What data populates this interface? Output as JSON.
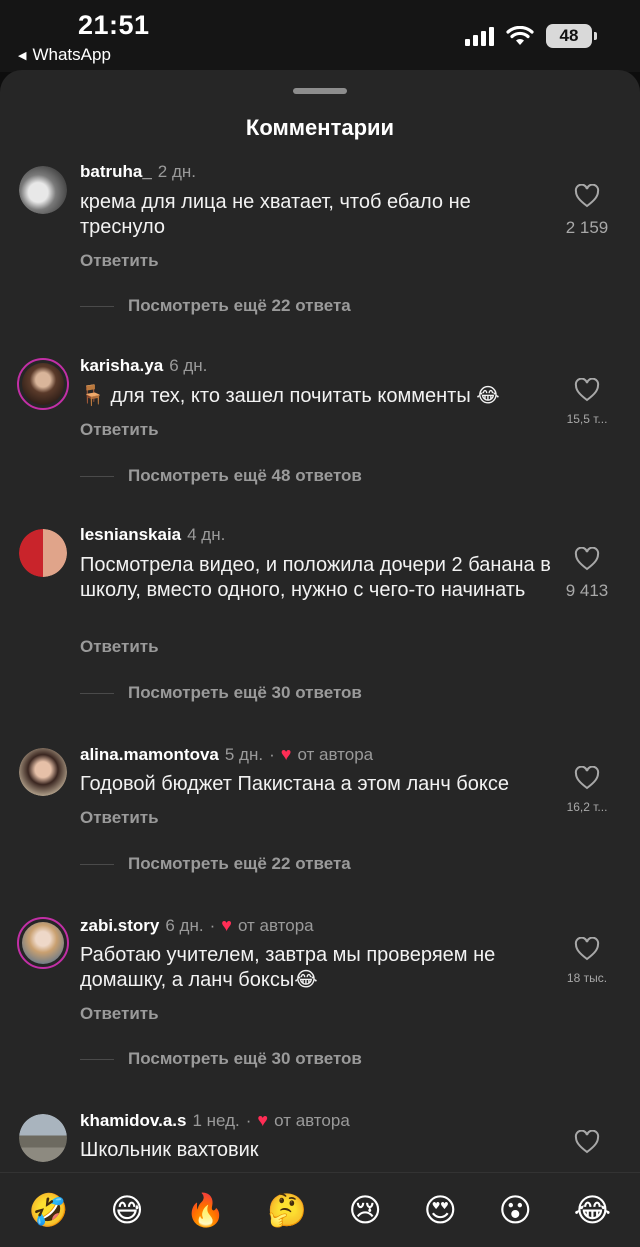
{
  "status_bar": {
    "time": "21:51",
    "back_app": "WhatsApp",
    "battery": "48"
  },
  "sheet": {
    "title": "Комментарии"
  },
  "comments": [
    {
      "user": "batruha_",
      "date": "2 дн.",
      "text": "крема для лица не хватает, чтоб ебало не треснуло",
      "likes": "2 159",
      "reply": "Ответить",
      "more": "Посмотреть ещё 22 ответа",
      "author_like": false
    },
    {
      "user": "karisha.ya",
      "date": "6 дн.",
      "text": "🪑 для тех, кто зашел почитать комменты 😂",
      "likes": "15,5 т...",
      "reply": "Ответить",
      "more": "Посмотреть ещё 48 ответов",
      "author_like": false
    },
    {
      "user": "lesnianskaia",
      "date": "4 дн.",
      "text": "Посмотрела видео, и положила дочери 2 банана в школу, вместо одного, нужно с чего-то начинать",
      "likes": "9 413",
      "reply": "Ответить",
      "more": "Посмотреть ещё 30 ответов",
      "author_like": false
    },
    {
      "user": "alina.mamontova",
      "date": "5 дн.",
      "author_label": "от автора",
      "text": "Годовой бюджет Пакистана а этом ланч боксе",
      "likes": "16,2 т...",
      "reply": "Ответить",
      "more": "Посмотреть ещё 22 ответа",
      "author_like": true
    },
    {
      "user": "zabi.story",
      "date": "6 дн.",
      "author_label": "от автора",
      "text": "Работаю учителем, завтра мы проверяем не домашку, а ланч боксы😂",
      "likes": "18 тыс.",
      "reply": "Ответить",
      "more": "Посмотреть ещё 30 ответов",
      "author_like": true
    },
    {
      "user": "khamidov.a.s",
      "date": "1 нед.",
      "author_label": "от автора",
      "text": "Школьник вахтовик",
      "likes": "",
      "author_like": true
    }
  ],
  "separator": "·",
  "emoji_bar": [
    "🤣",
    "😅",
    "🔥",
    "🤔",
    "😢",
    "😍",
    "😮",
    "😂"
  ],
  "colors": {
    "sheet_bg": "#262626",
    "author_heart": "#ff2d55",
    "ring": "#c22fa6"
  }
}
